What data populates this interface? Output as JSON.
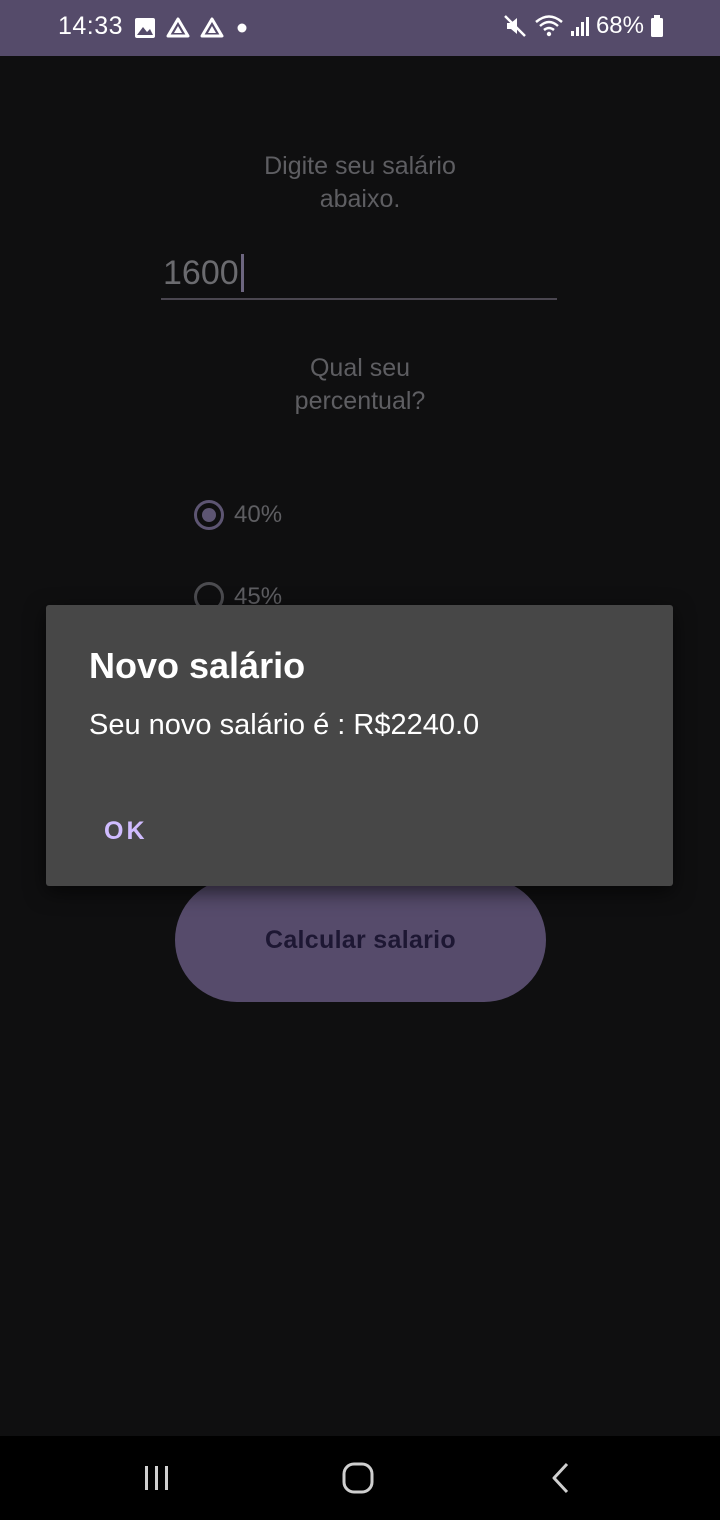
{
  "status_bar": {
    "time": "14:33",
    "battery": "68%",
    "icons": [
      "gallery-icon",
      "drive-icon",
      "drive-icon",
      "notification-dot-icon",
      "mute-icon",
      "wifi-icon",
      "signal-icon",
      "battery-icon"
    ]
  },
  "screen": {
    "salary_prompt_line1": "Digite seu salário",
    "salary_prompt_line2": "abaixo.",
    "salary_value": "1600",
    "percent_prompt_line1": "Qual seu",
    "percent_prompt_line2": "percentual?",
    "options": [
      {
        "label": "40%",
        "selected": true
      },
      {
        "label": "45%",
        "selected": false
      }
    ],
    "calc_button_label": "Calcular salario"
  },
  "dialog": {
    "title": "Novo salário",
    "message": "Seu novo salário é : R$2240.0",
    "ok_label": "OK"
  },
  "colors": {
    "status_bar": "#554b6a",
    "background": "#0f0f10",
    "dialog": "#474747",
    "accent": "#d0bcff",
    "button": "#564b6b"
  }
}
